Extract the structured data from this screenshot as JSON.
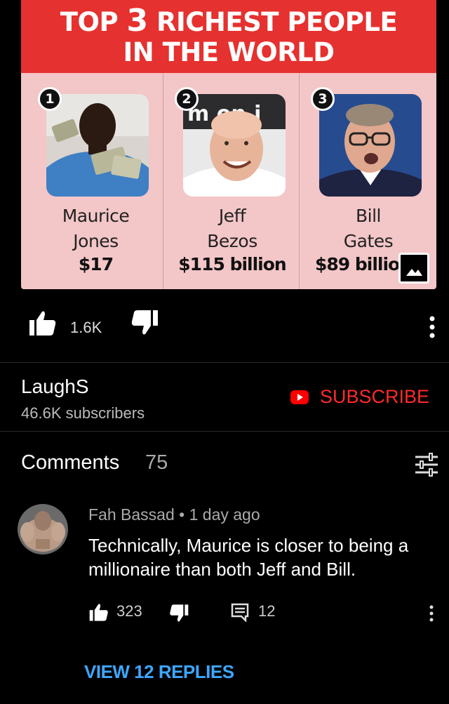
{
  "post": {
    "banner_top": "TOP",
    "banner_number": "3",
    "banner_rest": "RICHEST PEOPLE",
    "banner_line2": "IN THE WORLD",
    "people": [
      {
        "rank": "1",
        "first": "Maurice",
        "last": "Jones",
        "worth": "$17"
      },
      {
        "rank": "2",
        "first": "Jeff",
        "last": "Bezos",
        "worth": "$115 billion"
      },
      {
        "rank": "3",
        "first": "Bill",
        "last": "Gates",
        "worth": "$89 billio"
      }
    ],
    "amazon_text": "m  on.i",
    "colors": {
      "banner": "#e5312f",
      "panel": "#f3c6c8"
    }
  },
  "actions": {
    "like_count": "1.6K",
    "like_icon": "thumb-up-icon",
    "dislike_icon": "thumb-down-icon",
    "more_icon": "more-vert-icon"
  },
  "channel": {
    "name": "LaughS",
    "subscribers": "46.6K subscribers",
    "subscribe_label": "SUBSCRIBE",
    "accent": "#ff2a2a"
  },
  "comments": {
    "title": "Comments",
    "count": "75",
    "sort_icon": "sort-icon",
    "items": [
      {
        "author": "Fah Bassad",
        "separator": "•",
        "time": "1 day ago",
        "text": "Technically, Maurice is closer to being a millionaire than both Jeff and Bill.",
        "likes": "323",
        "replies": "12"
      }
    ],
    "view_replies": "VIEW 12 REPLIES",
    "link_color": "#3ea6ff"
  }
}
